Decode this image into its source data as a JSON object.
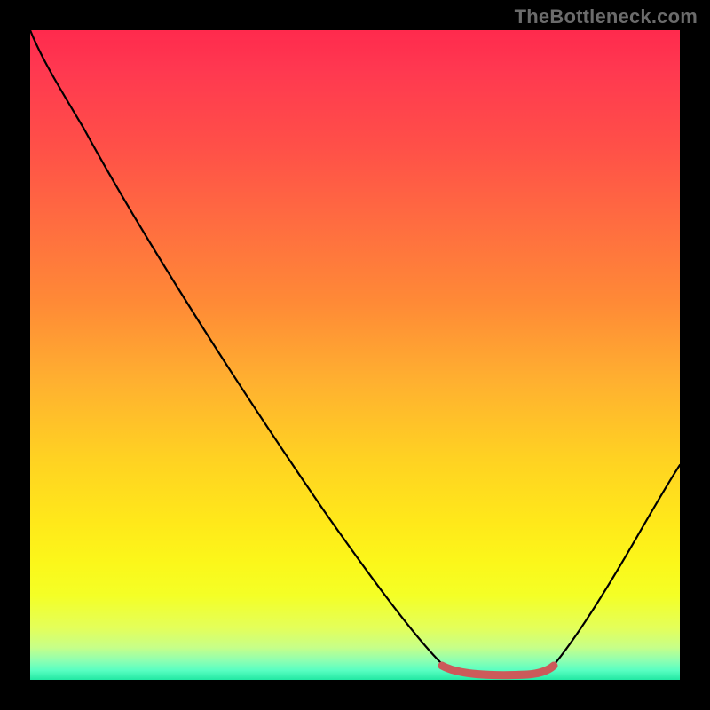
{
  "watermark": "TheBottleneck.com",
  "colors": {
    "background": "#000000",
    "line": "#000000",
    "highlight": "#cc5a5a",
    "gradient_top": "#ff2a4d",
    "gradient_bottom": "#22e8a3"
  },
  "chart_data": {
    "type": "line",
    "title": "",
    "xlabel": "",
    "ylabel": "",
    "xlim": [
      0,
      100
    ],
    "ylim": [
      0,
      100
    ],
    "grid": false,
    "note": "Axes unlabeled; values are relative positions read from the plot area (0–100).",
    "series": [
      {
        "name": "curve",
        "x": [
          0,
          2,
          8,
          20,
          35,
          50,
          57,
          60,
          63,
          72,
          75,
          80,
          85,
          92,
          100
        ],
        "y": [
          100,
          96,
          88,
          71,
          50,
          29,
          19,
          13,
          7,
          1,
          1,
          1,
          6,
          17,
          33
        ]
      }
    ],
    "highlight_range": {
      "x_start": 63,
      "x_end": 80,
      "y": 1
    }
  }
}
